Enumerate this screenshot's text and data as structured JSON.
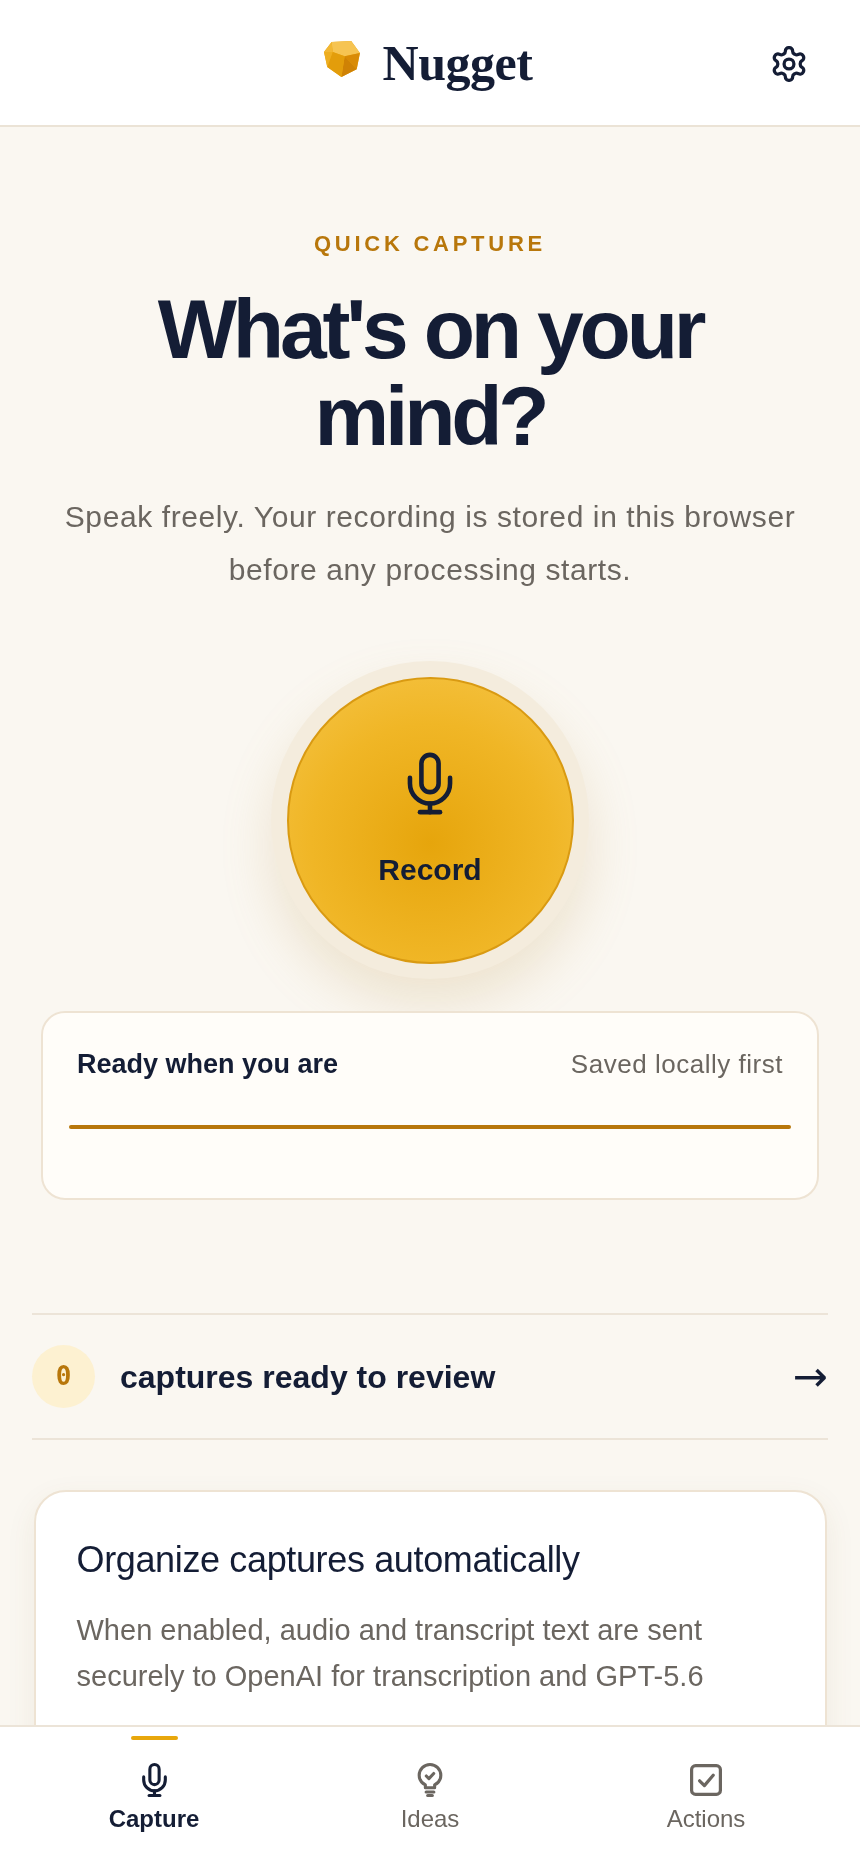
{
  "header": {
    "brand": "Nugget"
  },
  "hero": {
    "eyebrow": "QUICK CAPTURE",
    "title": "What's on your mind?",
    "subtitle": "Speak freely. Your recording is stored in this browser before any processing starts."
  },
  "record_button": {
    "label": "Record"
  },
  "status_card": {
    "status": "Ready when you are",
    "note": "Saved locally first"
  },
  "review_row": {
    "count": "0",
    "label": "captures ready to review",
    "arrow": "→"
  },
  "organize_card": {
    "title": "Organize captures automatically",
    "body": "When enabled, audio and transcript text are sent securely to OpenAI for transcription and GPT-5.6"
  },
  "nav": {
    "tabs": [
      {
        "label": "Capture",
        "selected": true
      },
      {
        "label": "Ideas",
        "selected": false
      },
      {
        "label": "Actions",
        "selected": false
      }
    ]
  }
}
